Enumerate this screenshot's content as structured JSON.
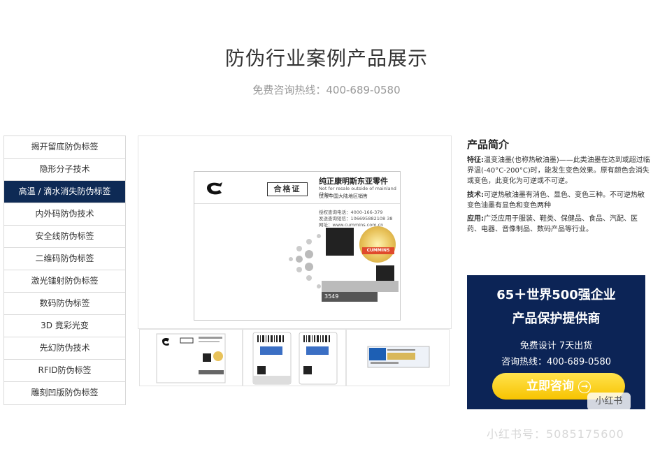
{
  "header": {
    "title": "防伪行业案例产品展示",
    "hotline": "免费咨询热线：400-689-0580"
  },
  "sidebar": {
    "items": [
      {
        "label": "揭开留底防伪标签"
      },
      {
        "label": "隐形分子技术"
      },
      {
        "label": "高温 / 滴水消失防伪标签",
        "active": true
      },
      {
        "label": "内外码防伪技术"
      },
      {
        "label": "安全线防伪标签"
      },
      {
        "label": "二维码防伪标签"
      },
      {
        "label": "激光镭射防伪标签"
      },
      {
        "label": "数码防伪标签"
      },
      {
        "label": "3D 竟彩光变"
      },
      {
        "label": "先幻防伪技术"
      },
      {
        "label": "RFID防伪标签"
      },
      {
        "label": "雕刻凹版防伪标签"
      }
    ]
  },
  "main_image": {
    "cert_label": "合格证",
    "genuine_title": "纯正康明斯东亚零件",
    "genuine_en": "Not for resale outside of mainland China",
    "genuine_cn": "仅限中国大陆地区销售",
    "phone1": "授权查询电话：4000-166-379",
    "phone2": "发送查询短信：106695882108 38",
    "website": "网址：www.cummins.com.cn",
    "brand_tag": "CUMMINS",
    "serial": "3549"
  },
  "intro": {
    "title": "产品简介",
    "feature_label": "特征:",
    "feature_text": "温变油墨(也称热敏油墨)——此类油墨在达到或超过临界温(-40°C-200°C)时，能发生变色效果。原有颜色会消失或变色，此变化为可逆或不可逆。",
    "tech_label": "技术:",
    "tech_text": "可逆热敏油墨有消色、显色、变色三种。不可逆热敏变色油墨有显色和变色两种",
    "app_label": "应用:",
    "app_text": "广泛应用于服装、鞋类、保健品、食品、汽配、医药、电器、音像制品、数码产品等行业。"
  },
  "ad": {
    "line1": "65＋世界500强企业",
    "line2": "产品保护提供商",
    "line3": "免费设计 7天出货",
    "line4": "咨询热线：400-689-0580",
    "button": "立即咨询"
  },
  "watermark": {
    "badge": "小红书",
    "id_text": "小红书号：5085175600"
  },
  "colors": {
    "nav_active_bg": "#0e2a55",
    "ad_bg": "#0c2456",
    "button_yellow": "#f7c300"
  }
}
